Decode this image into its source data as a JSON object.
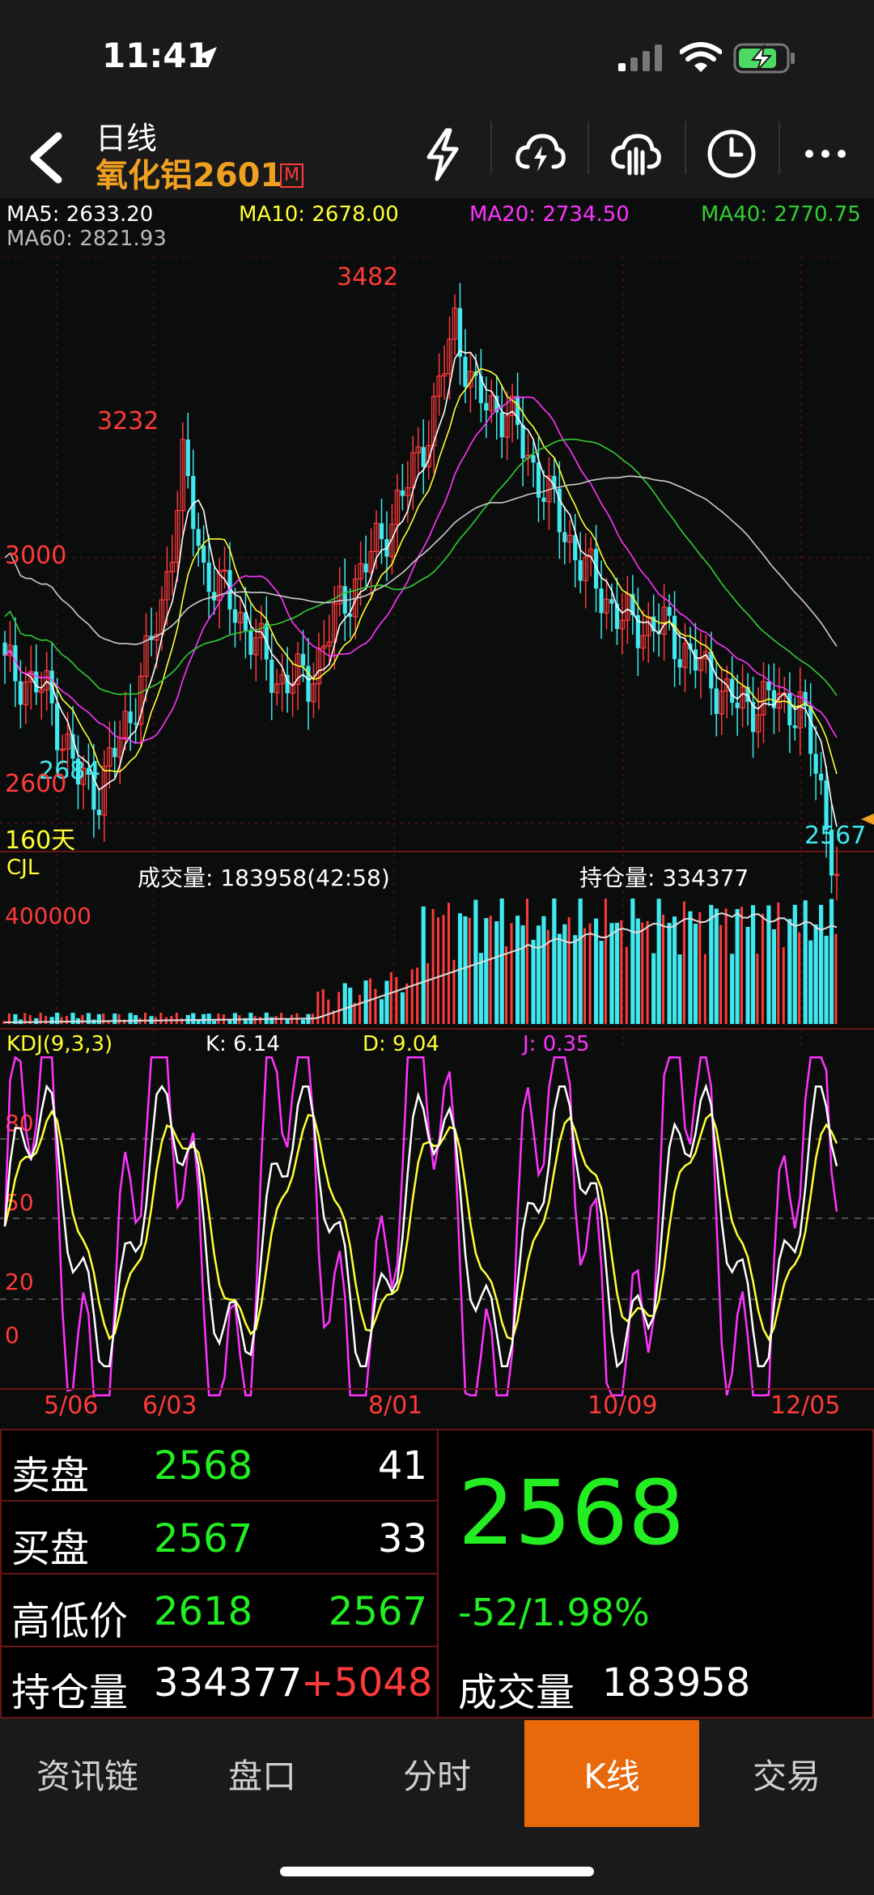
{
  "status": {
    "time": "11:41"
  },
  "header": {
    "period": "日线",
    "symbol": "氧化铝2601",
    "market_badge": "M"
  },
  "ma": {
    "ma5": "MA5: 2633.20",
    "ma10": "MA10: 2678.00",
    "ma20": "MA20: 2734.50",
    "ma40": "MA40: 2770.75",
    "ma60": "MA60: 2821.93"
  },
  "main_chart": {
    "price_labels": {
      "p3000": "3000",
      "p2600": "2600"
    },
    "peaks": {
      "p3482": "3482",
      "p3232": "3232",
      "p2684": "2684",
      "p2567": "2567"
    },
    "days": "160天"
  },
  "volume": {
    "name": "CJL",
    "volume_text": "成交量: 183958(42:58)",
    "oi_text": "持仓量: 334377",
    "axis_label": "400000"
  },
  "kdj": {
    "name": "KDJ(9,3,3)",
    "k": "K: 6.14",
    "d": "D: 9.04",
    "j": "J: 0.35",
    "levels": [
      "80",
      "50",
      "20",
      "0"
    ]
  },
  "dates": [
    "5/06",
    "6/03",
    "8/01",
    "10/09",
    "12/05"
  ],
  "quote": {
    "ask_label": "卖盘",
    "ask_price": "2568",
    "ask_qty": "41",
    "bid_label": "买盘",
    "bid_price": "2567",
    "bid_qty": "33",
    "hl_label": "高低价",
    "high": "2618",
    "low": "2567",
    "oi_label": "持仓量",
    "oi": "334377",
    "oi_change": "+5048",
    "last": "2568",
    "change": "-52/1.98%",
    "vol_label": "成交量",
    "vol": "183958"
  },
  "tabs": [
    "资讯链",
    "盘口",
    "分时",
    "K线",
    "交易"
  ],
  "colors": {
    "up": "#ff3a3a",
    "down": "#40e8ef",
    "ma5": "#ffffff",
    "ma10": "#ffff33",
    "ma20": "#ff33ff",
    "ma40": "#33cc33",
    "ma60": "#cccccc",
    "active_tab": "#e8680a"
  },
  "chart_data": {
    "type": "line",
    "title": "",
    "series": [
      {
        "name": "MA5",
        "values": [
          2880,
          2790,
          2760,
          3000,
          3160,
          2930,
          2840,
          2880,
          3040,
          3180,
          3380,
          3300,
          3280,
          3150,
          3000,
          2920,
          2880,
          2830,
          2820,
          2810,
          2780,
          2700,
          2633
        ]
      },
      {
        "name": "MA10",
        "values": [
          2900,
          2810,
          2780,
          2970,
          3080,
          2950,
          2860,
          2870,
          3000,
          3120,
          3320,
          3290,
          3260,
          3170,
          3040,
          2950,
          2900,
          2850,
          2830,
          2810,
          2790,
          2730,
          2678
        ]
      },
      {
        "name": "MA20",
        "values": [
          2960,
          2870,
          2820,
          2920,
          3020,
          2960,
          2890,
          2880,
          2960,
          3060,
          3230,
          3270,
          3260,
          3200,
          3100,
          3000,
          2930,
          2880,
          2850,
          2820,
          2800,
          2770,
          2734
        ]
      }
    ]
  }
}
